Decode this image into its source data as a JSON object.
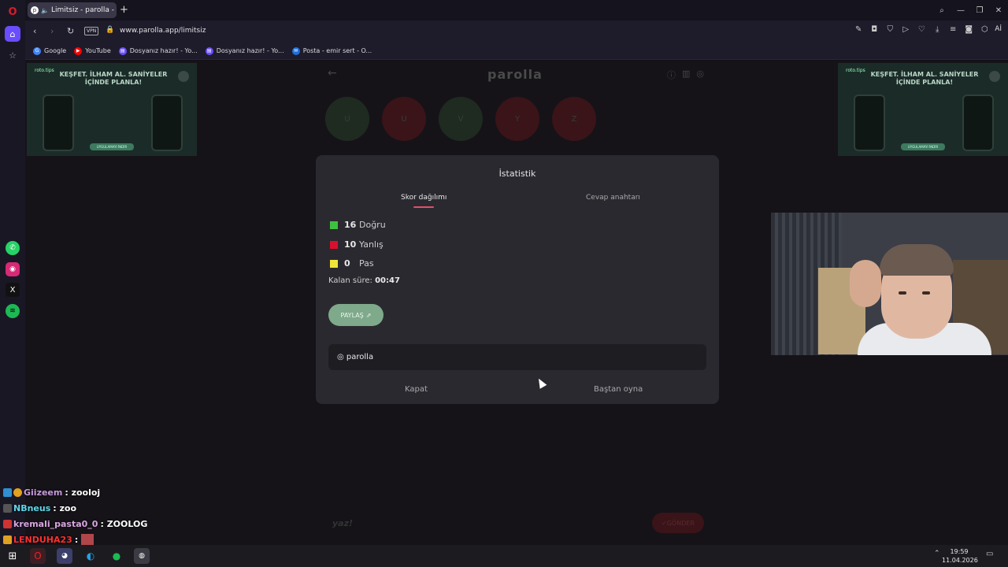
{
  "browser": {
    "tab_title": "Limitsiz - parolla - Ke",
    "new_tab": "+",
    "url": "www.parolla.app/limitsiz",
    "vpn": "VPN",
    "ai_label": "Aİ",
    "bookmarks": [
      {
        "label": "Google",
        "icon": "google-icon",
        "color": "#4285f4"
      },
      {
        "label": "YouTube",
        "icon": "youtube-icon",
        "color": "#ff0000"
      },
      {
        "label": "Dosyanız hazır! - Yo...",
        "icon": "doc-icon",
        "color": "#6a4dff"
      },
      {
        "label": "Dosyanız hazır! - Yo...",
        "icon": "doc-icon",
        "color": "#6a4dff"
      },
      {
        "label": "Posta - emir sert - O...",
        "icon": "mail-icon",
        "color": "#1e6fd9"
      }
    ]
  },
  "ad": {
    "brand": "roto.tips",
    "headline": "KEŞFET. İLHAM AL. SANİYELER İÇİNDE PLANLA!",
    "cta": "UYGULAMAYI İNDİR"
  },
  "app": {
    "logo": "parolla",
    "letters": [
      {
        "char": "U",
        "color": "#1f2b21"
      },
      {
        "char": "U",
        "color": "#3a1418"
      },
      {
        "char": "V",
        "color": "#1f2b21"
      },
      {
        "char": "Y",
        "color": "#3a1418"
      },
      {
        "char": "Z",
        "color": "#3a1418"
      }
    ],
    "answer_placeholder": "yaz!",
    "send_label": "GÖNDER"
  },
  "modal": {
    "title": "İstatistik",
    "tab_active": "Skor dağılımı",
    "tab_other": "Cevap anahtarı",
    "stats": [
      {
        "value": "16",
        "label": "Doğru",
        "color": "#3fc13f"
      },
      {
        "value": "10",
        "label": "Yanlış",
        "color": "#d8102e"
      },
      {
        "value": "0",
        "label": "Pas",
        "color": "#f0e43a"
      }
    ],
    "remaining_label": "Kalan süre:",
    "remaining_value": "00:47",
    "share_label": "PAYLAŞ",
    "word_row": "◎ parolla",
    "close_label": "Kapat",
    "replay_label": "Baştan oyna"
  },
  "chat": [
    {
      "user": "Giizeem",
      "message": ": zooloj",
      "user_color": "#c79bdc"
    },
    {
      "user": "NBneus",
      "message": ": zoo",
      "user_color": "#5fd6e8"
    },
    {
      "user": "kremali_pasta0_0",
      "message": ": ZOOLOG",
      "user_color": "#d9a6e0"
    },
    {
      "user": "LENDUHA23",
      "message": ":",
      "user_color": "#ff3030"
    }
  ],
  "taskbar": {
    "time": "19:59",
    "date": "11.04.2026"
  }
}
